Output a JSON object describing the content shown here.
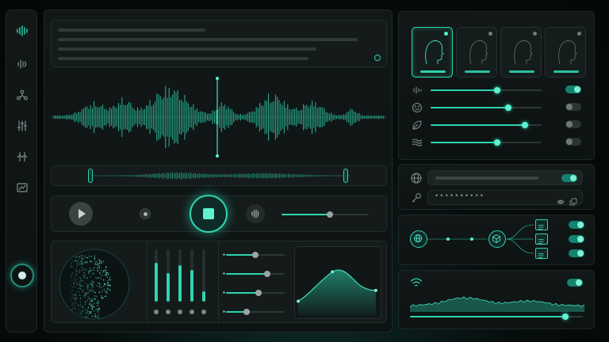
{
  "password_mask": "••••••••••",
  "colors": {
    "accent": "#2fd3b1",
    "bg": "#060b0b",
    "panel": "#121818"
  },
  "sidebar": {
    "icons": [
      "waveform-logo-icon",
      "audio-wave-icon",
      "nodes-icon",
      "equalizer-icon",
      "compare-icon",
      "bar-chart-icon",
      "record-icon"
    ]
  },
  "transport": {
    "volume": 0.55,
    "playing": false
  },
  "voices": {
    "count": 4,
    "selected": 0
  },
  "voice_params": [
    0.6,
    0.7,
    0.85,
    0.6
  ],
  "voice_toggles": [
    true,
    false,
    false,
    false
  ],
  "channel_levels": [
    0.75,
    0.55,
    0.7,
    0.6,
    0.2
  ],
  "mini_sliders": [
    0.5,
    0.7,
    0.55,
    0.35
  ],
  "flow_toggles": [
    true,
    true,
    true
  ],
  "settings_toggles": {
    "url_toggle": true
  },
  "progress": 0.9
}
